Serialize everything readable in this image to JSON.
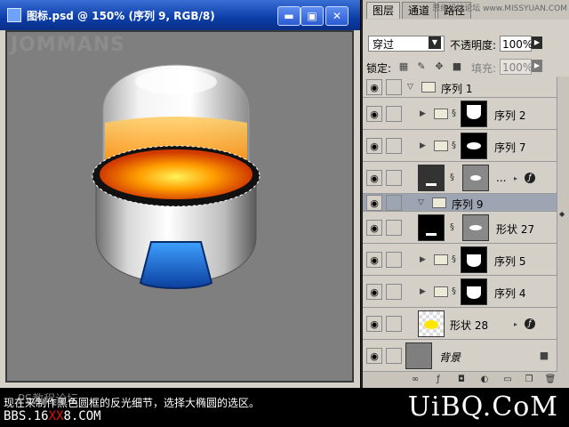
{
  "document": {
    "title": "图标.psd @ 150% (序列 9, RGB/8)",
    "watermark": "JOMMANS",
    "buttons": {
      "minimize": "▬",
      "maximize": "▣",
      "close": "✕"
    }
  },
  "layers_panel": {
    "tabs": [
      "图层",
      "通道",
      "路径"
    ],
    "site_mark": "思缘设计论坛 www.MISSYUAN.COM",
    "blend_mode": "穿过",
    "opacity_label": "不透明度:",
    "opacity_value": "100%",
    "lock_label": "锁定:",
    "fill_label": "填充:",
    "fill_value": "100%",
    "layers": [
      {
        "name": "序列 1",
        "type": "group",
        "expanded": true
      },
      {
        "name": "序列 2",
        "type": "group",
        "expanded": false
      },
      {
        "name": "序列 7",
        "type": "group",
        "expanded": false
      },
      {
        "name": "...",
        "type": "layer",
        "has_fx": true
      },
      {
        "name": "序列 9",
        "type": "group",
        "expanded": true,
        "selected": true
      },
      {
        "name": "形状 27",
        "type": "layer"
      },
      {
        "name": "序列 5",
        "type": "group",
        "expanded": false
      },
      {
        "name": "序列 4",
        "type": "group",
        "expanded": false
      },
      {
        "name": "形状 28",
        "type": "layer",
        "has_fx": true
      },
      {
        "name": "背景",
        "type": "background"
      }
    ],
    "footer_icons": [
      "link-icon",
      "fx-icon",
      "mask-icon",
      "new-fill-icon",
      "new-group-icon",
      "new-layer-icon",
      "trash-icon"
    ]
  },
  "bottom": {
    "caption": "现在来制作黑色圆框的反光细节，选择大椭圆的选区。",
    "ps_forum": "PS教程论坛",
    "bbs_prefix": "BBS.16",
    "bbs_red": "XX",
    "bbs_suffix": "8.COM",
    "brand": "UiBQ.CoM"
  },
  "colors": {
    "titlebar": "#0b3ea7",
    "canvas_bg": "#7f7f7f",
    "panel_bg": "#d4d0c8",
    "selected_row": "#9da4b2"
  }
}
